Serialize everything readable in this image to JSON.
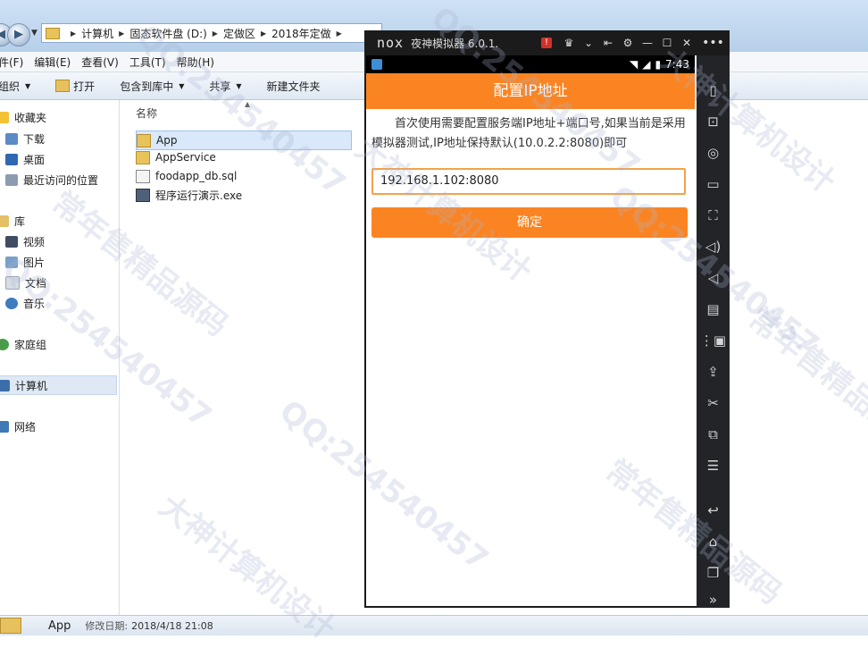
{
  "explorer": {
    "breadcrumbs": [
      "计算机",
      "固态软件盘 (D:)",
      "定做区",
      "2018年定做"
    ],
    "menu": [
      "件(F)",
      "编辑(E)",
      "查看(V)",
      "工具(T)",
      "帮助(H)"
    ],
    "toolbar": {
      "organize": "组织",
      "open": "打开",
      "include_library": "包含到库中",
      "share": "共享",
      "new_folder": "新建文件夹"
    },
    "nav": {
      "favorites": "收藏夹",
      "downloads": "下载",
      "desktop": "桌面",
      "recent": "最近访问的位置",
      "libraries": "库",
      "videos": "视频",
      "pictures": "图片",
      "documents": "文档",
      "music": "音乐",
      "homegroup": "家庭组",
      "computer": "计算机",
      "network": "网络"
    },
    "column_header": "名称",
    "files": [
      {
        "name": "App",
        "icon": "folder-icon"
      },
      {
        "name": "AppService",
        "icon": "folder-icon"
      },
      {
        "name": "foodapp_db.sql",
        "icon": "file-icon"
      },
      {
        "name": "程序运行演示.exe",
        "icon": "exe-icon"
      }
    ],
    "status": {
      "name": "App",
      "modified_label": "修改日期:",
      "modified_value": "2018/4/18 21:08"
    }
  },
  "nox": {
    "logo": "nox",
    "title": "夜神模拟器 6.0.1.",
    "android_time": "7:43",
    "app_title": "配置IP地址",
    "description": "首次使用需要配置服务端IP地址+端口号,如果当前是采用模拟器测试,IP地址保持默认(10.0.2.2:8080)即可",
    "ip_value": "192.168.1.102:8080",
    "confirm_label": "确定"
  },
  "watermarks": [
    "QQ:254540457",
    "大神计算机设计",
    "常年售精品源码"
  ],
  "colors": {
    "accent_orange": "#fb8422",
    "input_border": "#f3a24c",
    "nox_dark": "#1b1b1b"
  }
}
